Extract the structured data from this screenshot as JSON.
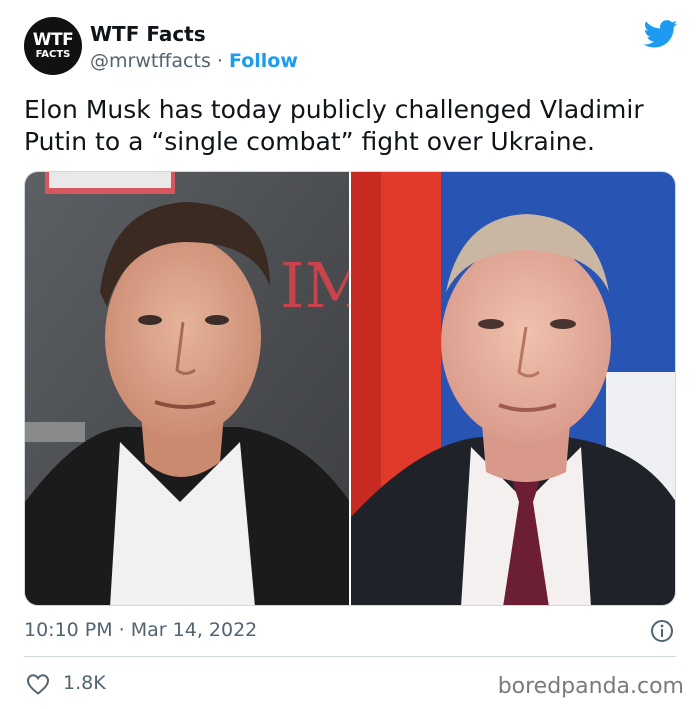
{
  "account": {
    "display_name": "WTF Facts",
    "handle": "@mrwtffacts",
    "separator": "·",
    "follow_label": "Follow",
    "avatar_line1": "WTF",
    "avatar_line2": "FACTS"
  },
  "tweet": {
    "text": "Elon Musk has today publicly challenged Vladimir Putin to a “single combat” fight over Ukraine.",
    "timestamp": "10:10 PM · Mar 14, 2022",
    "like_count": "1.8K"
  },
  "media": {
    "photo_overlay_text": "IM",
    "count": 2
  },
  "watermark": "boredpanda.com",
  "colors": {
    "twitter_blue": "#1d9bf0",
    "secondary_text": "#536471",
    "divider": "#cfd9de"
  },
  "icons": {
    "brand": "twitter-bird-icon",
    "info": "info-icon",
    "like": "heart-icon"
  }
}
